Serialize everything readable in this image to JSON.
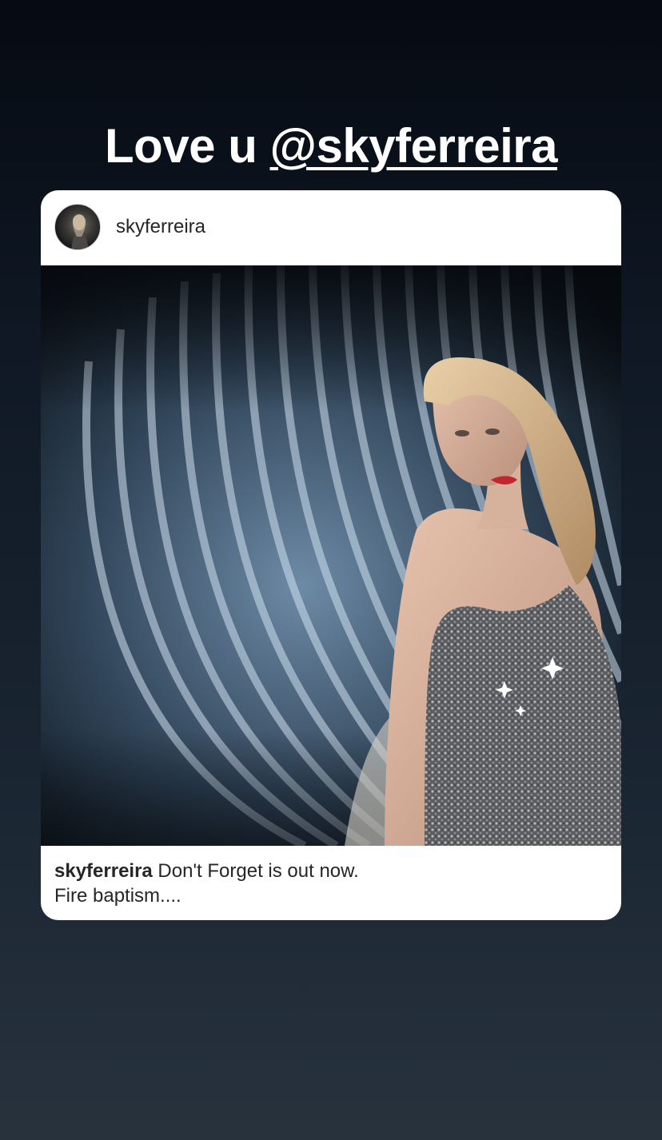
{
  "story": {
    "caption_prefix": "Love u ",
    "caption_mention": "@skyferreira"
  },
  "post": {
    "username": "skyferreira",
    "caption_username": "skyferreira",
    "caption_text": " Don't Forget is out now.",
    "caption_line2": "Fire baptism....",
    "photo_icon": "photo-of-woman-in-sequin-dress"
  }
}
